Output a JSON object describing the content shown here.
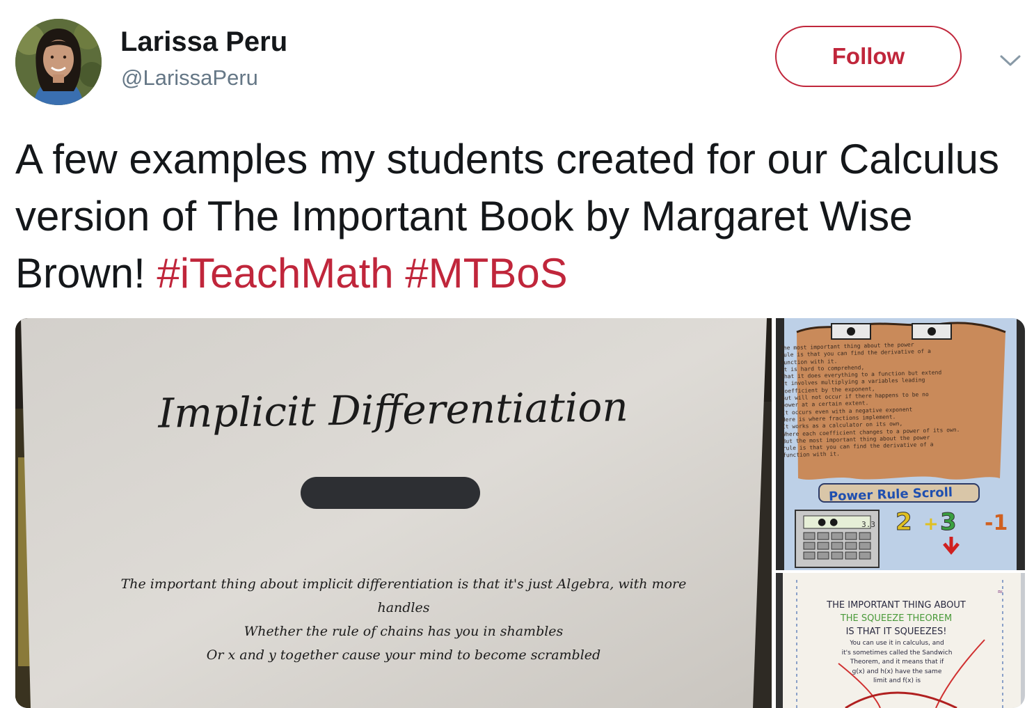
{
  "tweet": {
    "author_name": "Larissa Peru",
    "author_handle": "@LarissaPeru",
    "follow_label": "Follow",
    "text_plain": "A few examples my students created for our Calculus version of The Important Book by Margaret Wise Brown!",
    "hashtags": [
      "#iTeachMath",
      "#MTBoS"
    ]
  },
  "colors": {
    "accent": "#c0263b",
    "text": "#14171a",
    "secondary_text": "#657786"
  },
  "icons": {
    "more": "chevron-down-icon"
  },
  "media": {
    "main_photo": {
      "title": "Implicit Differentiation",
      "lines": [
        "The important thing about implicit differentiation is that it's just Algebra, with more",
        "handles",
        "Whether the rule of chains has you in shambles",
        "Or x and y together cause your mind to become scrambled"
      ]
    },
    "side_photo_top": {
      "scroll_lines": [
        "The most important thing about the power",
        "rule is that you can find the derivative of a",
        "function with it.",
        "It is hard to comprehend,",
        "That it does everything to a function but extend",
        "It involves multiplying a variables leading",
        "coefficient by the exponent,",
        "But will not occur if there happens to be no",
        "power at a certain extent.",
        "It occurs even with a negative exponent",
        "Here is where fractions implement.",
        "It works as a calculator on its own,",
        "Where each coefficient changes to a power of its own.",
        "But the most important thing about the power",
        "rule is that you can find the derivative of a",
        "function with it."
      ],
      "label": "Power Rule Scroll",
      "calculator_display": "3.3"
    },
    "side_photo_bottom": {
      "heading_lines": [
        "THE IMPORTANT THING ABOUT",
        "THE SQUEEZE THEOREM",
        "IS THAT IT SQUEEZES!"
      ],
      "body_lines": [
        "You can use it in calculus, and",
        "it's sometimes called the Sandwich",
        "Theorem, and it means that if",
        "g(x) and h(x) have the same",
        "limit and f(x) is"
      ]
    }
  }
}
